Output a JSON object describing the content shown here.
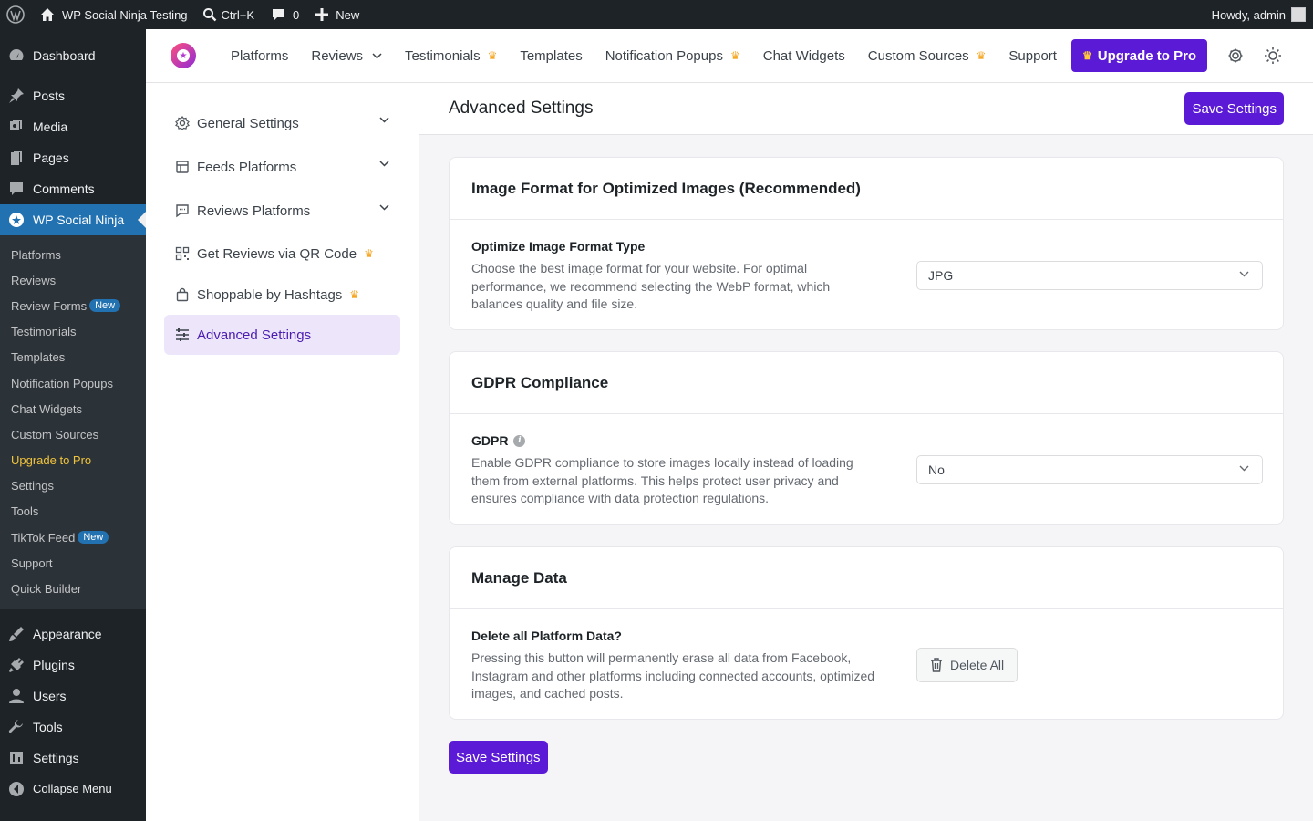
{
  "adminbar": {
    "site_name": "WP Social Ninja Testing",
    "search_shortcut": "Ctrl+K",
    "comments_count": "0",
    "new_label": "New",
    "howdy": "Howdy, admin"
  },
  "sidebar": {
    "items_top": [
      {
        "label": "Dashboard",
        "icon": "dashboard-icon"
      },
      {
        "label": "Posts",
        "icon": "pin-icon"
      },
      {
        "label": "Media",
        "icon": "media-icon"
      },
      {
        "label": "Pages",
        "icon": "page-icon"
      },
      {
        "label": "Comments",
        "icon": "comment-icon"
      },
      {
        "label": "WP Social Ninja",
        "icon": "ninja-icon"
      }
    ],
    "submenu": [
      {
        "label": "Platforms"
      },
      {
        "label": "Reviews"
      },
      {
        "label": "Review Forms",
        "badge": "New"
      },
      {
        "label": "Testimonials"
      },
      {
        "label": "Templates"
      },
      {
        "label": "Notification Popups"
      },
      {
        "label": "Chat Widgets"
      },
      {
        "label": "Custom Sources"
      },
      {
        "label": "Upgrade to Pro"
      },
      {
        "label": "Settings"
      },
      {
        "label": "Tools"
      },
      {
        "label": "TikTok Feed",
        "badge": "New"
      },
      {
        "label": "Support"
      },
      {
        "label": "Quick Builder"
      }
    ],
    "items_bottom": [
      {
        "label": "Appearance",
        "icon": "brush-icon"
      },
      {
        "label": "Plugins",
        "icon": "plugin-icon"
      },
      {
        "label": "Users",
        "icon": "user-icon"
      },
      {
        "label": "Tools",
        "icon": "wrench-icon"
      },
      {
        "label": "Settings",
        "icon": "settings-icon"
      },
      {
        "label": "Collapse Menu",
        "icon": "collapse-icon"
      }
    ]
  },
  "topnav": {
    "links": [
      {
        "label": "Platforms"
      },
      {
        "label": "Reviews"
      },
      {
        "label": "Testimonials"
      },
      {
        "label": "Templates"
      },
      {
        "label": "Notification Popups"
      },
      {
        "label": "Chat Widgets"
      },
      {
        "label": "Custom Sources"
      },
      {
        "label": "Support"
      }
    ],
    "upgrade_label": "Upgrade to Pro"
  },
  "settings_nav": [
    {
      "label": "General Settings"
    },
    {
      "label": "Feeds Platforms"
    },
    {
      "label": "Reviews Platforms"
    },
    {
      "label": "Get Reviews via QR Code"
    },
    {
      "label": "Shoppable by Hashtags"
    },
    {
      "label": "Advanced Settings"
    }
  ],
  "main": {
    "title": "Advanced Settings",
    "save_label": "Save Settings",
    "cards": [
      {
        "title": "Image Format for Optimized Images (Recommended)",
        "field_label": "Optimize Image Format Type",
        "description": "Choose the best image format for your website. For optimal performance, we recommend selecting the WebP format, which balances quality and file size.",
        "value": "JPG"
      },
      {
        "title": "GDPR Compliance",
        "field_label": "GDPR",
        "description": "Enable GDPR compliance to store images locally instead of loading them from external platforms. This helps protect user privacy and ensures compliance with data protection regulations.",
        "value": "No"
      },
      {
        "title": "Manage Data",
        "field_label": "Delete all Platform Data?",
        "description": "Pressing this button will permanently erase all data from Facebook, Instagram and other platforms including connected accounts, optimized images, and cached posts.",
        "button_label": "Delete All"
      }
    ],
    "bottom_save_label": "Save Settings"
  },
  "colors": {
    "brand": "#5b1ad6",
    "wp_dark": "#1d2327",
    "wp_blue": "#2271b1"
  }
}
